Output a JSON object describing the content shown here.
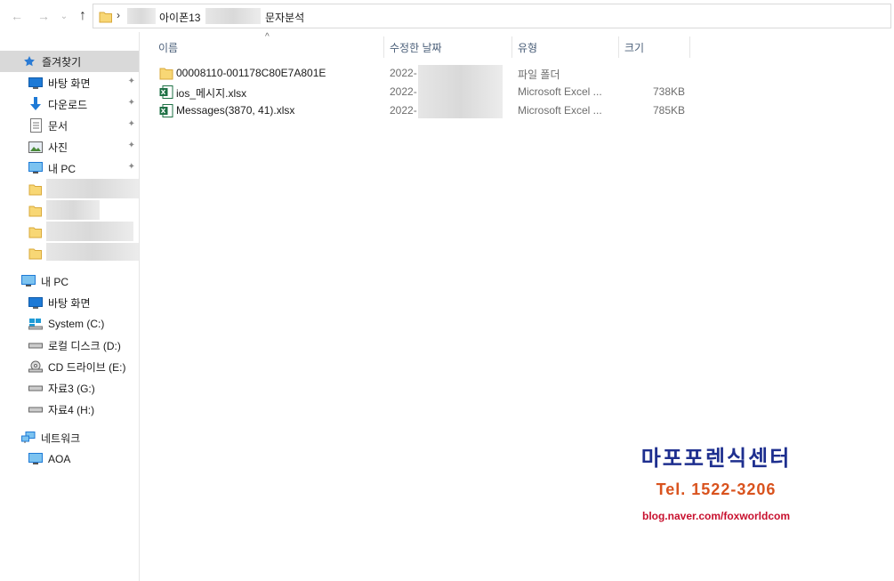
{
  "nav": {
    "back_icon": "←",
    "forward_icon": "→",
    "recent_icon": "⌄",
    "up_icon": "↑"
  },
  "address": {
    "separator": "›",
    "crumb_1": "아이폰13",
    "crumb_2": "문자분석"
  },
  "sidebar": {
    "quick_access": "즐겨찾기",
    "items": [
      {
        "label": "바탕 화면"
      },
      {
        "label": "다운로드"
      },
      {
        "label": "문서"
      },
      {
        "label": "사진"
      },
      {
        "label": "내 PC"
      }
    ],
    "pin_icon": "📌",
    "this_pc": "내 PC",
    "pc_items": [
      {
        "label": "바탕 화면"
      },
      {
        "label": "System (C:)"
      },
      {
        "label": "로컬 디스크 (D:)"
      },
      {
        "label": "CD 드라이브 (E:)"
      },
      {
        "label": "자료3 (G:)"
      },
      {
        "label": "자료4 (H:)"
      }
    ],
    "network": "네트워크",
    "network_items": [
      {
        "label": "AOA"
      }
    ]
  },
  "columns": {
    "name": "이름",
    "modified": "수정한 날짜",
    "type": "유형",
    "size": "크기",
    "sort_indicator": "^"
  },
  "files": [
    {
      "name": "00008110-001178C80E7A801E",
      "modified": "2022-",
      "type": "파일 폴더",
      "size": ""
    },
    {
      "name": "ios_메시지.xlsx",
      "modified": "2022-",
      "type": "Microsoft Excel ...",
      "size": "738KB"
    },
    {
      "name": "Messages(3870, 41).xlsx",
      "modified": "2022-",
      "type": "Microsoft Excel ...",
      "size": "785KB"
    }
  ],
  "watermark": {
    "title": "마포포렌식센터",
    "tel": "Tel. 1522-3206",
    "url": "blog.naver.com/foxworldcom"
  },
  "colors": {
    "folder": "#f8d775",
    "excel": "#1d7044",
    "selected": "#d9d9d9",
    "pc_blue": "#1e7ad6"
  }
}
